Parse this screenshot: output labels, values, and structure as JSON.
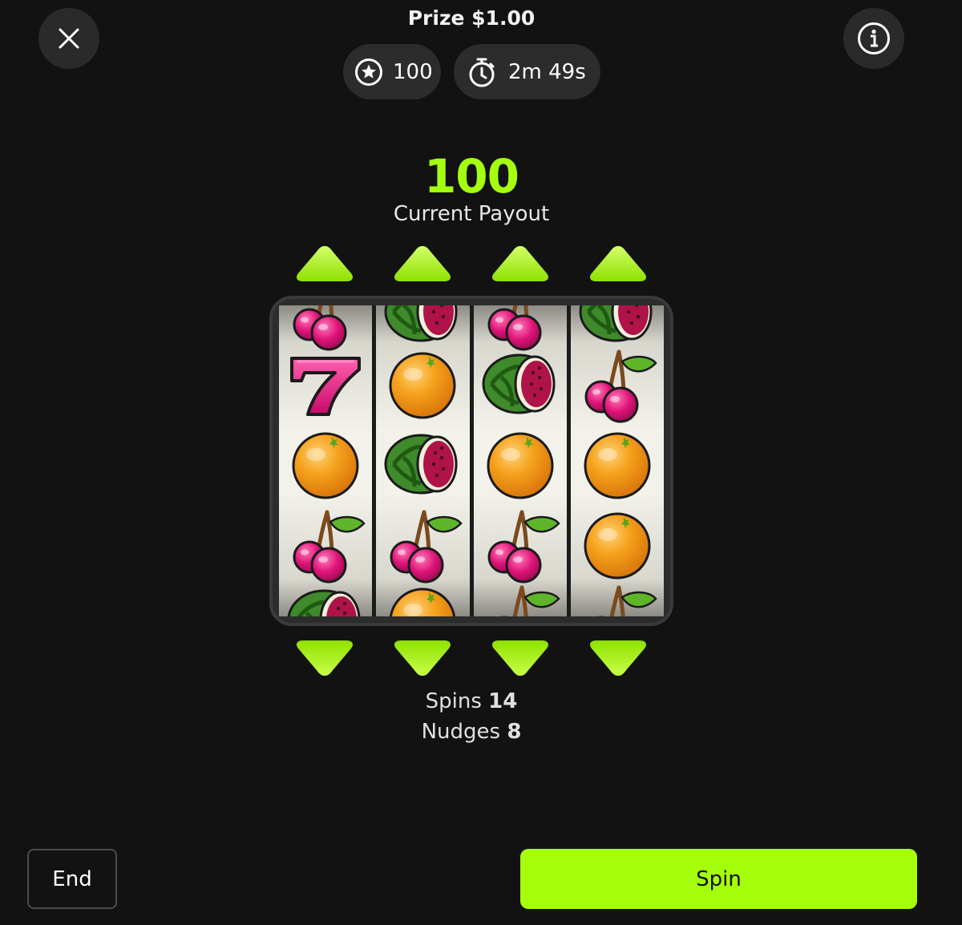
{
  "header": {
    "prize_text": "Prize $1.00",
    "points": "100",
    "timer": "2m 49s"
  },
  "payout": {
    "value": "100",
    "label": "Current Payout"
  },
  "reels": [
    [
      "cherry",
      "seven",
      "orange",
      "cherry",
      "watermelon"
    ],
    [
      "watermelon",
      "orange",
      "watermelon",
      "cherry",
      "orange"
    ],
    [
      "cherry",
      "watermelon",
      "orange",
      "cherry",
      "cherry"
    ],
    [
      "watermelon",
      "cherry",
      "orange",
      "orange",
      "cherry"
    ]
  ],
  "stats": {
    "spins_label": "Spins",
    "spins_value": "14",
    "nudges_label": "Nudges",
    "nudges_value": "8"
  },
  "actions": {
    "end_label": "End",
    "spin_label": "Spin"
  },
  "colors": {
    "accent": "#a6ff0a",
    "background": "#121212"
  },
  "icons": {
    "close": "close-icon",
    "info": "info-icon",
    "points": "star-circle-icon",
    "timer": "stopwatch-icon",
    "nudge_up": "arrow-up-icon",
    "nudge_down": "arrow-down-icon"
  }
}
